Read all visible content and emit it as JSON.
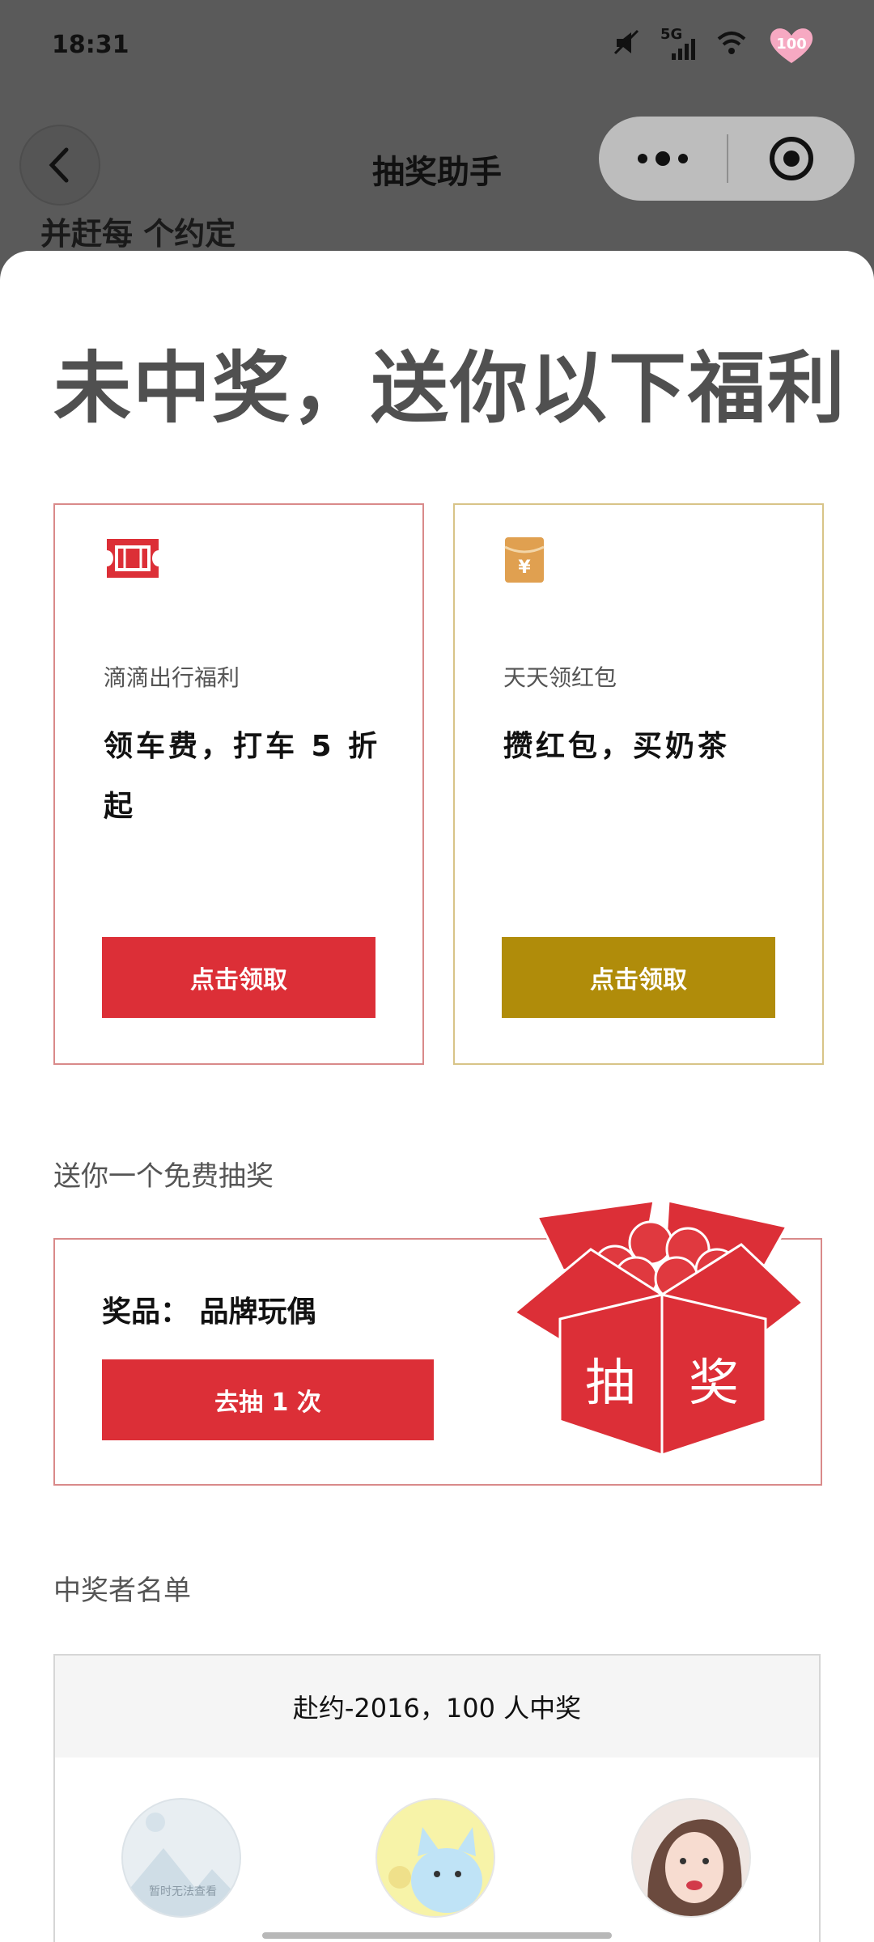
{
  "status_bar": {
    "time": "18:31",
    "network": "5G",
    "battery": "100"
  },
  "nav": {
    "title": "抽奖助手"
  },
  "peek_text": "并赶每 个约定",
  "sheet": {
    "title": "未中奖，送你以下福利"
  },
  "cards": [
    {
      "subtitle": "滴滴出行福利",
      "main": "领车费，打车 5 折起",
      "button": "点击领取",
      "icon": "ticket-icon",
      "color": "#dc2f37"
    },
    {
      "subtitle": "天天领红包",
      "main": "攒红包，买奶茶",
      "button": "点击领取",
      "icon": "red-packet-icon",
      "color": "#b08c0a"
    }
  ],
  "free_lottery": {
    "label": "送你一个免费抽奖",
    "prize": "奖品： 品牌玩偶",
    "button": "去抽 1 次",
    "box_text_left": "抽",
    "box_text_right": "奖"
  },
  "winners": {
    "label": "中奖者名单",
    "header": "赴约-2016，100 人中奖",
    "avatar_placeholder_text": "暂时无法查看"
  }
}
